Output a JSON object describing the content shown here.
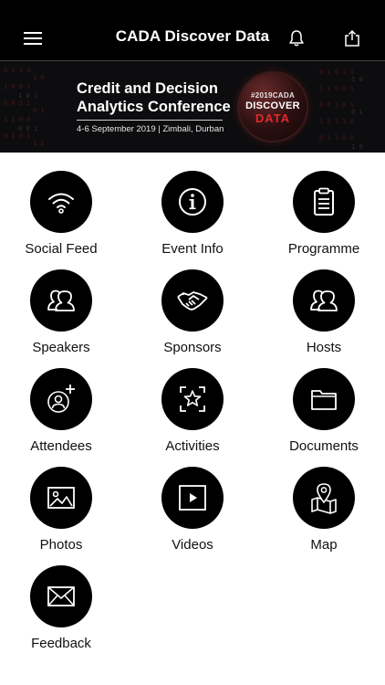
{
  "header": {
    "title": "CADA Discover Data",
    "menu_icon": "hamburger-menu-icon",
    "bell_icon": "bell-icon",
    "share_icon": "share-icon"
  },
  "banner": {
    "headline_line1": "Credit and Decision",
    "headline_line2": "Analytics Conference",
    "dateline": "4-6 September 2019 | Zimbali, Durban",
    "seal_line1": "#2019CADA",
    "seal_line2": "DISCOVER",
    "seal_line3": "DATA",
    "accent_color": "#e02a2a"
  },
  "tiles": [
    {
      "label": "Social Feed",
      "icon": "wifi-icon"
    },
    {
      "label": "Event Info",
      "icon": "info-icon"
    },
    {
      "label": "Programme",
      "icon": "clipboard-icon"
    },
    {
      "label": "Speakers",
      "icon": "people-icon"
    },
    {
      "label": "Sponsors",
      "icon": "handshake-icon"
    },
    {
      "label": "Hosts",
      "icon": "people-icon"
    },
    {
      "label": "Attendees",
      "icon": "add-user-icon"
    },
    {
      "label": "Activities",
      "icon": "star-frame-icon"
    },
    {
      "label": "Documents",
      "icon": "folder-icon"
    },
    {
      "label": "Photos",
      "icon": "image-icon"
    },
    {
      "label": "Videos",
      "icon": "play-icon"
    },
    {
      "label": "Map",
      "icon": "map-pin-icon"
    },
    {
      "label": "Feedback",
      "icon": "envelope-icon"
    }
  ]
}
